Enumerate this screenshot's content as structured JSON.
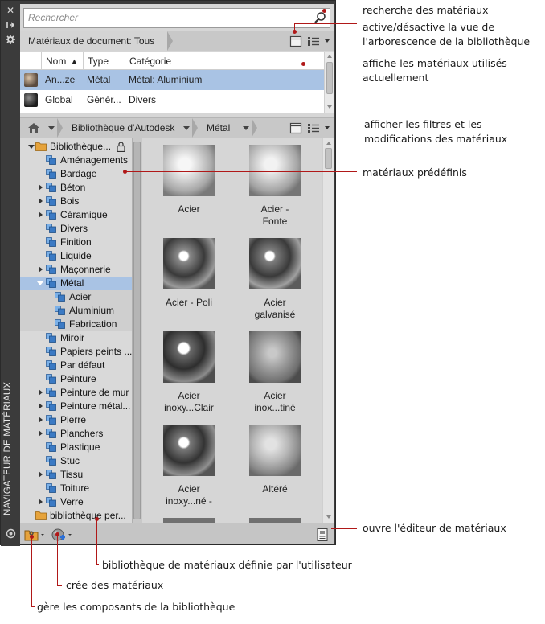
{
  "palette": {
    "vertical_title": "NAVIGATEUR DE MATÉRIAUX",
    "titlebar_icons": [
      "close-icon",
      "autohide-icon",
      "properties-icon"
    ]
  },
  "search": {
    "placeholder": "Rechercher"
  },
  "document_bar": {
    "breadcrumb": "Matériaux de document: Tous"
  },
  "document_table": {
    "columns": [
      "Nom",
      "Type",
      "Catégorie"
    ],
    "sort_indicator": "▲",
    "rows": [
      {
        "name": "An...ze",
        "type": "Métal",
        "category": "Métal: Aluminium",
        "selected": true
      },
      {
        "name": "Global",
        "type": "Génér...",
        "category": "Divers",
        "selected": false
      }
    ]
  },
  "library_bar": {
    "breadcrumbs": [
      "Bibliothèque d'Autodesk",
      "Métal"
    ]
  },
  "tree": {
    "root": "Bibliothèque...",
    "items": [
      "Aménagements",
      "Bardage",
      "Béton",
      "Bois",
      "Céramique",
      "Divers",
      "Finition",
      "Liquide",
      "Maçonnerie",
      "Métal"
    ],
    "metal_children": [
      "Acier",
      "Aluminium",
      "Fabrication"
    ],
    "items_after": [
      "Miroir",
      "Papiers peints ...",
      "Par défaut",
      "Peinture",
      "Peinture de mur",
      "Peinture métal...",
      "Pierre",
      "Planchers",
      "Plastique",
      "Stuc",
      "Tissu",
      "Toiture",
      "Verre"
    ],
    "user_library": "bibliothèque per..."
  },
  "materials": [
    {
      "line1": "Acier",
      "line2": ""
    },
    {
      "line1": "Acier -",
      "line2": "Fonte"
    },
    {
      "line1": "Acier - Poli",
      "line2": ""
    },
    {
      "line1": "Acier",
      "line2": "galvanisé"
    },
    {
      "line1": "Acier",
      "line2": "inoxy...Clair"
    },
    {
      "line1": "Acier",
      "line2": "inox...tiné"
    },
    {
      "line1": "Acier",
      "line2": "inoxy...né -"
    },
    {
      "line1": "Altéré",
      "line2": ""
    }
  ],
  "annotations": {
    "search": "recherche des matériaux",
    "toggle_tree_1": "active/désactive la vue de",
    "toggle_tree_2": "l'arborescence de la bibliothèque",
    "in_use_1": "affiche les matériaux utilisés",
    "in_use_2": "actuellement",
    "filters_1": "afficher les filtres et les",
    "filters_2": "modifications des matériaux",
    "predefined": "matériaux prédéfinis",
    "open_editor": "ouvre l'éditeur de matériaux",
    "user_library": "bibliothèque de matériaux définie par l'utilisateur",
    "create": "crée des matériaux",
    "manage": "gère les composants de la bibliothèque"
  },
  "colors": {
    "selection": "#a9c3e4",
    "callout": "#b01818",
    "folder": "#e6a33b",
    "material_icon": "#3b7ac4"
  }
}
